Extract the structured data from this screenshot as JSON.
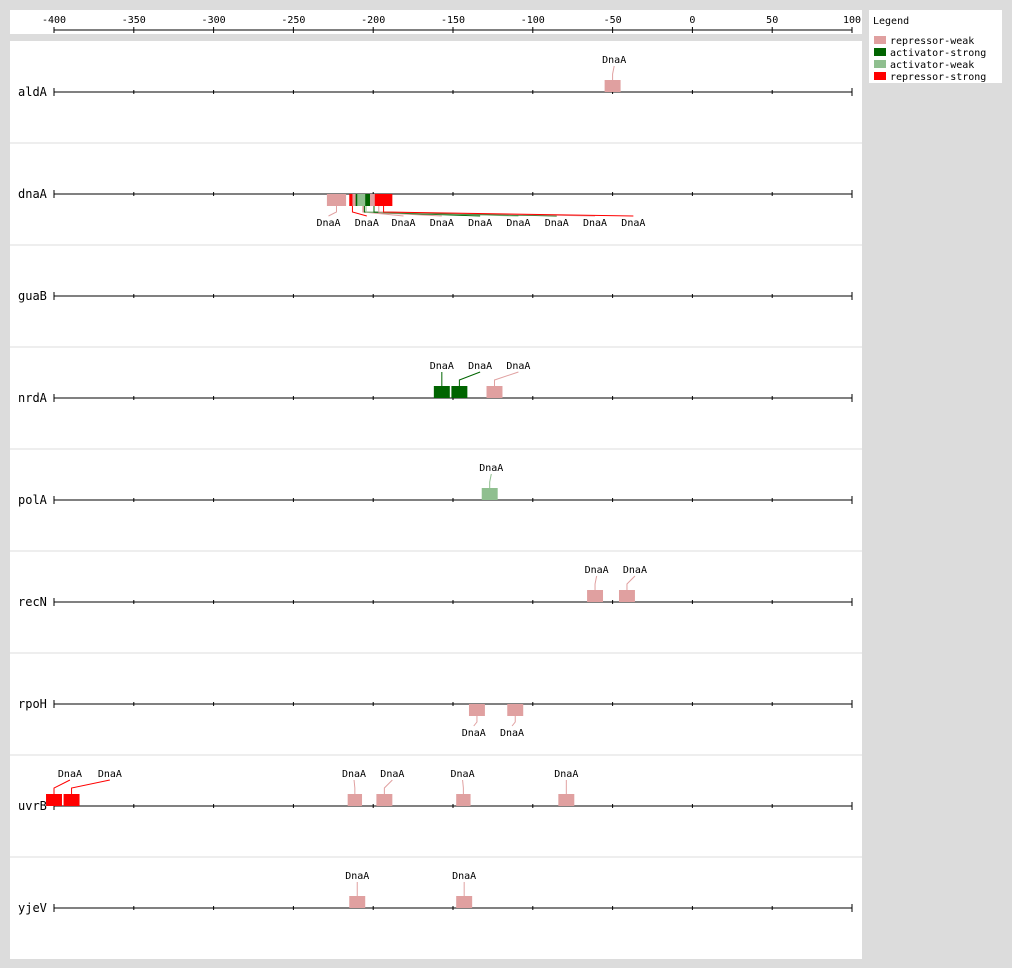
{
  "chart_data": {
    "type": "sequence-track",
    "xlim": [
      -400,
      100
    ],
    "axis_ticks": [
      -400,
      -350,
      -300,
      -250,
      -200,
      -150,
      -100,
      -50,
      0,
      50,
      100
    ],
    "legend": {
      "title": "Legend",
      "items": [
        {
          "key": "repressor-weak",
          "label": "repressor-weak",
          "color": "#e0a0a0"
        },
        {
          "key": "activator-strong",
          "label": "activator-strong",
          "color": "#006400"
        },
        {
          "key": "activator-weak",
          "label": "activator-weak",
          "color": "#8fbf8f"
        },
        {
          "key": "repressor-strong",
          "label": "repressor-strong",
          "color": "#ff0000"
        }
      ]
    },
    "genes": [
      {
        "name": "aldA",
        "sites": [
          {
            "start": -55,
            "end": -45,
            "type": "repressor-weak",
            "label": "DnaA",
            "side": "above",
            "label_pos": -49
          }
        ]
      },
      {
        "name": "dnaA",
        "sites": [
          {
            "start": -229,
            "end": -217,
            "type": "repressor-weak",
            "label": "DnaA",
            "side": "below",
            "label_pos": -228
          },
          {
            "start": -215,
            "end": -211,
            "type": "repressor-strong",
            "label": "DnaA",
            "side": "below",
            "label_pos": -204
          },
          {
            "start": -213,
            "end": -199,
            "type": "repressor-weak",
            "label": "DnaA",
            "side": "below",
            "label_pos": -181
          },
          {
            "start": -212,
            "end": -201,
            "type": "repressor-weak",
            "label": "DnaA",
            "side": "below",
            "label_pos": -157
          },
          {
            "start": -211,
            "end": -200,
            "type": "activator-strong",
            "label": "DnaA",
            "side": "below",
            "label_pos": -133
          },
          {
            "start": -210,
            "end": -199,
            "type": "activator-weak",
            "label": "DnaA",
            "side": "below",
            "label_pos": -109
          },
          {
            "start": -205,
            "end": -194,
            "type": "activator-strong",
            "label": "DnaA",
            "side": "below",
            "label_pos": -85
          },
          {
            "start": -202,
            "end": -191,
            "type": "repressor-weak",
            "label": "DnaA",
            "side": "below",
            "label_pos": -61
          },
          {
            "start": -199,
            "end": -188,
            "type": "repressor-strong",
            "label": "DnaA",
            "side": "below",
            "label_pos": -37
          }
        ]
      },
      {
        "name": "guaB",
        "sites": []
      },
      {
        "name": "nrdA",
        "sites": [
          {
            "start": -162,
            "end": -152,
            "type": "activator-strong",
            "label": "DnaA",
            "side": "above",
            "label_pos": -157
          },
          {
            "start": -151,
            "end": -141,
            "type": "activator-strong",
            "label": "DnaA",
            "side": "above",
            "label_pos": -133
          },
          {
            "start": -129,
            "end": -119,
            "type": "repressor-weak",
            "label": "DnaA",
            "side": "above",
            "label_pos": -109
          }
        ]
      },
      {
        "name": "polA",
        "sites": [
          {
            "start": -132,
            "end": -122,
            "type": "activator-weak",
            "label": "DnaA",
            "side": "above",
            "label_pos": -126
          }
        ]
      },
      {
        "name": "recN",
        "sites": [
          {
            "start": -66,
            "end": -56,
            "type": "repressor-weak",
            "label": "DnaA",
            "side": "above",
            "label_pos": -60
          },
          {
            "start": -46,
            "end": -36,
            "type": "repressor-weak",
            "label": "DnaA",
            "side": "above",
            "label_pos": -36
          }
        ]
      },
      {
        "name": "rpoH",
        "sites": [
          {
            "start": -140,
            "end": -130,
            "type": "repressor-weak",
            "label": "DnaA",
            "side": "below",
            "label_pos": -137
          },
          {
            "start": -116,
            "end": -106,
            "type": "repressor-weak",
            "label": "DnaA",
            "side": "below",
            "label_pos": -113
          }
        ]
      },
      {
        "name": "uvrB",
        "sites": [
          {
            "start": -405,
            "end": -395,
            "type": "repressor-strong",
            "label": "DnaA",
            "side": "above",
            "label_pos": -390
          },
          {
            "start": -394,
            "end": -384,
            "type": "repressor-strong",
            "label": "DnaA",
            "side": "above",
            "label_pos": -365
          },
          {
            "start": -216,
            "end": -207,
            "type": "repressor-weak",
            "label": "DnaA",
            "side": "above",
            "label_pos": -212
          },
          {
            "start": -198,
            "end": -188,
            "type": "repressor-weak",
            "label": "DnaA",
            "side": "above",
            "label_pos": -188
          },
          {
            "start": -148,
            "end": -139,
            "type": "repressor-weak",
            "label": "DnaA",
            "side": "above",
            "label_pos": -144
          },
          {
            "start": -84,
            "end": -74,
            "type": "repressor-weak",
            "label": "DnaA",
            "side": "above",
            "label_pos": -79
          }
        ]
      },
      {
        "name": "yjeV",
        "sites": [
          {
            "start": -215,
            "end": -205,
            "type": "repressor-weak",
            "label": "DnaA",
            "side": "above",
            "label_pos": -210
          },
          {
            "start": -148,
            "end": -138,
            "type": "repressor-weak",
            "label": "DnaA",
            "side": "above",
            "label_pos": -143
          }
        ]
      }
    ]
  }
}
